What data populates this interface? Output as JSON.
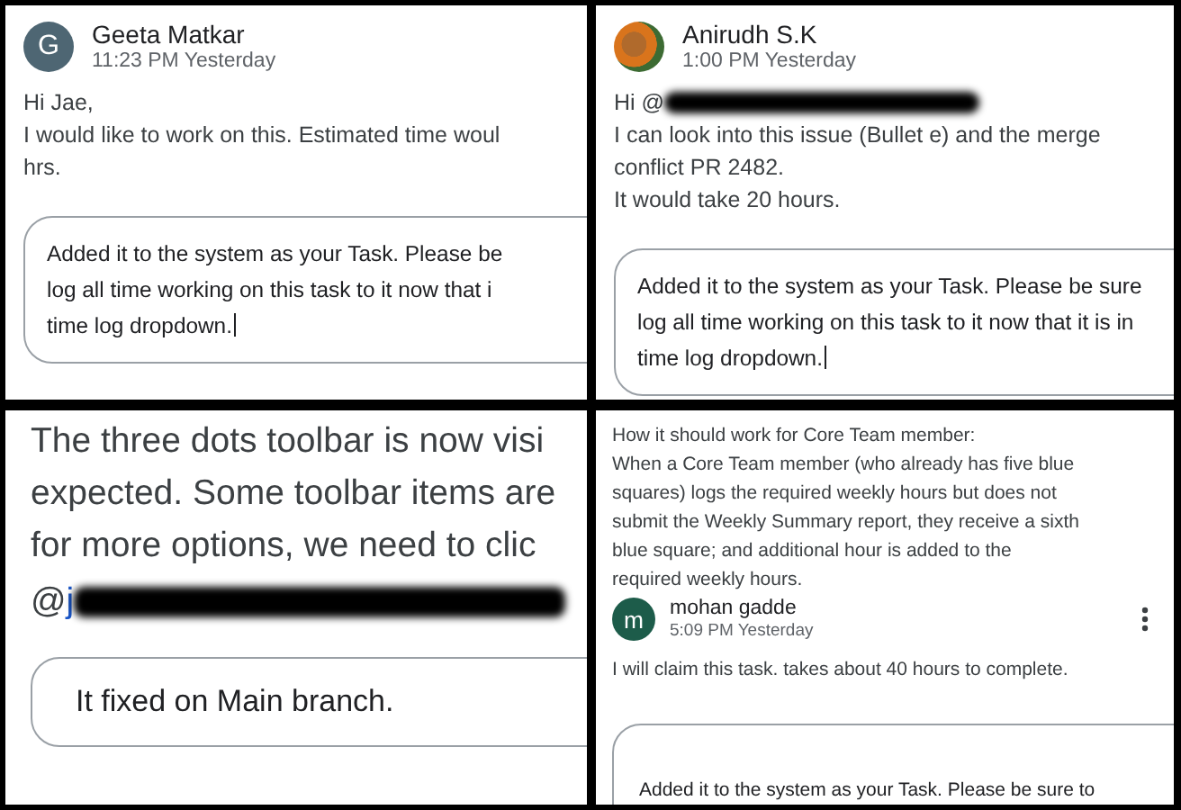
{
  "panels": [
    {
      "kind": "normal",
      "items": [
        {
          "kind": "header",
          "name": "Geeta Matkar",
          "time": "11:23 PM Yesterday",
          "avatar": {
            "kind": "letter",
            "letter": "G",
            "color": "#4e6673"
          },
          "menu": false
        },
        {
          "kind": "text",
          "lines": [
            "Hi Jae,",
            "I would like to work on this. Estimated time woul",
            "hrs."
          ]
        },
        {
          "kind": "reply",
          "lines": [
            "Added it to the system as your Task. Please be",
            "log all time working on this task to it now that i",
            "time log dropdown."
          ],
          "cursor": true
        }
      ]
    },
    {
      "kind": "normal",
      "items": [
        {
          "kind": "header",
          "name": "Anirudh S.K",
          "time": "1:00 PM Yesterday",
          "avatar": {
            "kind": "photo"
          },
          "menu": false
        },
        {
          "kind": "mention",
          "prefix": "Hi @"
        },
        {
          "kind": "text",
          "lines": [
            "I can look into this issue (Bullet e) and the merge",
            "conflict PR 2482.",
            "It would take 20 hours."
          ]
        },
        {
          "kind": "reply",
          "lines": [
            "Added it to the system as your Task. Please be sure",
            "log all time working on this task to it now that it is in",
            "time log dropdown."
          ],
          "cursor": true
        }
      ]
    },
    {
      "kind": "zoomed",
      "items": [
        {
          "kind": "text",
          "lines": [
            "The three dots toolbar is now visi",
            "expected. Some toolbar items are",
            "for more options, we need to clic"
          ]
        },
        {
          "kind": "mention",
          "prefix": "@",
          "link": "j"
        },
        {
          "kind": "reply",
          "lines": [
            "It fixed on Main branch."
          ],
          "cursor": false
        }
      ]
    },
    {
      "kind": "compact",
      "items": [
        {
          "kind": "text",
          "lines": [
            "How it should work for Core Team member:",
            "When a Core Team member (who already has five blue",
            "squares) logs the required weekly hours but does not",
            "submit the Weekly Summary report, they receive a sixth",
            "blue square; and additional hour is added to the",
            "required weekly hours."
          ]
        },
        {
          "kind": "header",
          "name": "mohan gadde",
          "time": "5:09 PM Yesterday",
          "avatar": {
            "kind": "letter",
            "letter": "m",
            "color": "#1d5c4a"
          },
          "menu": true
        },
        {
          "kind": "text",
          "lines": [
            "I will claim this task. takes about 40 hours to complete."
          ]
        },
        {
          "kind": "reply",
          "lines": [
            "Added it to the system as your Task. Please be sure to"
          ],
          "cursor": false
        }
      ]
    }
  ]
}
